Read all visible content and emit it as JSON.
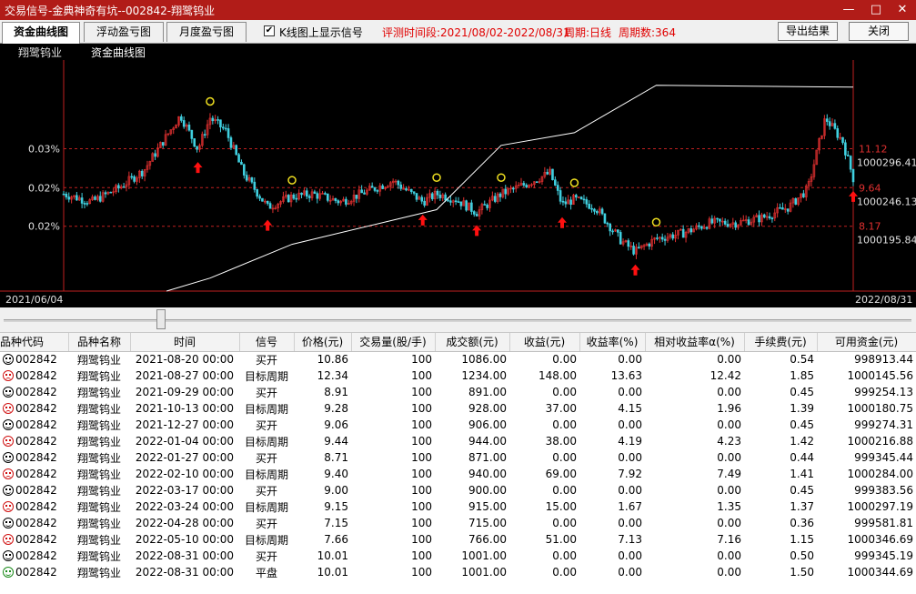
{
  "window": {
    "title": "交易信号-金典神奇有坑--002842-翔鹭钨业",
    "controls": {
      "minimize": "—",
      "maximize": "□",
      "close": "✕"
    }
  },
  "toolbar": {
    "tabs": [
      {
        "label": "资金曲线图",
        "active": true
      },
      {
        "label": "浮动盈亏图",
        "active": false
      },
      {
        "label": "月度盈亏图",
        "active": false
      }
    ],
    "checkbox_checked": true,
    "checkbox_label": "K线图上显示信号",
    "period_text": "评测时间段:2021/08/02-2022/08/31",
    "cycle_text": "周期:日线",
    "cycle_count_text": "周期数:364",
    "export_button": "导出结果",
    "close_button": "关闭"
  },
  "chart_data": {
    "type": "line",
    "legend": [
      "翔鹭钨业",
      "资金曲线图"
    ],
    "x_start_label": "2021/06/04",
    "x_end_label": "2022/08/31",
    "left_axis_labels": [
      "0.03%",
      "0.02%",
      "0.02%"
    ],
    "right_price_labels": [
      "11.12",
      "9.64",
      "8.17"
    ],
    "right_equity_labels": [
      "1000296.41",
      "1000246.13",
      "1000195.84"
    ],
    "price_ylim": [
      5.7,
      14.5
    ],
    "equity_ylim": [
      1000132,
      1000373
    ],
    "equity_series": {
      "name": "资金曲线图",
      "color": "#ffffff",
      "x": [
        "2021-08-02",
        "2021-08-27",
        "2021-10-13",
        "2022-01-04",
        "2022-02-10",
        "2022-03-24",
        "2022-05-10",
        "2022-08-31"
      ],
      "values": [
        1000132,
        1000145.56,
        1000180.75,
        1000216.88,
        1000284.0,
        1000297.19,
        1000346.69,
        1000344.69
      ]
    },
    "price_series": {
      "name": "翔鹭钨业",
      "up_color": "#e03030",
      "down_color": "#40d0e0",
      "x": [
        "2021-06-04",
        "2021-06-20",
        "2021-07-05",
        "2021-07-20",
        "2021-08-02",
        "2021-08-10",
        "2021-08-20",
        "2021-08-27",
        "2021-09-05",
        "2021-09-15",
        "2021-09-29",
        "2021-10-13",
        "2021-10-25",
        "2021-11-10",
        "2021-11-25",
        "2021-12-10",
        "2021-12-27",
        "2022-01-04",
        "2022-01-15",
        "2022-01-27",
        "2022-02-10",
        "2022-02-25",
        "2022-03-10",
        "2022-03-17",
        "2022-03-24",
        "2022-04-05",
        "2022-04-20",
        "2022-04-28",
        "2022-05-10",
        "2022-05-25",
        "2022-06-10",
        "2022-06-25",
        "2022-07-10",
        "2022-07-25",
        "2022-08-05",
        "2022-08-15",
        "2022-08-25",
        "2022-08-31"
      ],
      "values": [
        9.4,
        9.1,
        9.6,
        10.3,
        11.6,
        12.4,
        11.1,
        12.3,
        11.8,
        10.2,
        8.9,
        9.3,
        9.4,
        9.1,
        9.5,
        9.9,
        9.1,
        9.4,
        9.2,
        8.7,
        9.4,
        9.8,
        10.2,
        9.0,
        9.2,
        8.9,
        7.6,
        7.2,
        7.7,
        7.9,
        8.3,
        8.3,
        8.5,
        8.9,
        9.6,
        12.3,
        11.4,
        10.0
      ]
    },
    "signals": [
      {
        "date": "2021-08-20",
        "kind": "buy"
      },
      {
        "date": "2021-08-27",
        "kind": "sell"
      },
      {
        "date": "2021-09-29",
        "kind": "buy"
      },
      {
        "date": "2021-10-13",
        "kind": "sell"
      },
      {
        "date": "2021-12-27",
        "kind": "buy"
      },
      {
        "date": "2022-01-04",
        "kind": "sell"
      },
      {
        "date": "2022-01-27",
        "kind": "buy"
      },
      {
        "date": "2022-02-10",
        "kind": "sell"
      },
      {
        "date": "2022-03-17",
        "kind": "buy"
      },
      {
        "date": "2022-03-24",
        "kind": "sell"
      },
      {
        "date": "2022-04-28",
        "kind": "buy"
      },
      {
        "date": "2022-05-10",
        "kind": "sell"
      },
      {
        "date": "2022-08-31",
        "kind": "buy"
      }
    ]
  },
  "table": {
    "headers": [
      "品种代码",
      "品种名称",
      "时间",
      "信号",
      "价格(元)",
      "交易量(股/手)",
      "成交额(元)",
      "收益(元)",
      "收益率(%)",
      "相对收益率α(%)",
      "手续费(元)",
      "可用资金(元)"
    ],
    "rows": [
      {
        "face": "black",
        "code": "002842",
        "name": "翔鹭钨业",
        "time": "2021-08-20 00:00",
        "signal": "买开",
        "price": "10.86",
        "volume": "100",
        "amount": "1086.00",
        "profit": "0.00",
        "rate": "0.00",
        "alpha": "0.00",
        "fee": "0.54",
        "cash": "998913.44"
      },
      {
        "face": "red",
        "code": "002842",
        "name": "翔鹭钨业",
        "time": "2021-08-27 00:00",
        "signal": "目标周期",
        "price": "12.34",
        "volume": "100",
        "amount": "1234.00",
        "profit": "148.00",
        "rate": "13.63",
        "alpha": "12.42",
        "fee": "1.85",
        "cash": "1000145.56"
      },
      {
        "face": "black",
        "code": "002842",
        "name": "翔鹭钨业",
        "time": "2021-09-29 00:00",
        "signal": "买开",
        "price": "8.91",
        "volume": "100",
        "amount": "891.00",
        "profit": "0.00",
        "rate": "0.00",
        "alpha": "0.00",
        "fee": "0.45",
        "cash": "999254.13"
      },
      {
        "face": "red",
        "code": "002842",
        "name": "翔鹭钨业",
        "time": "2021-10-13 00:00",
        "signal": "目标周期",
        "price": "9.28",
        "volume": "100",
        "amount": "928.00",
        "profit": "37.00",
        "rate": "4.15",
        "alpha": "1.96",
        "fee": "1.39",
        "cash": "1000180.75"
      },
      {
        "face": "black",
        "code": "002842",
        "name": "翔鹭钨业",
        "time": "2021-12-27 00:00",
        "signal": "买开",
        "price": "9.06",
        "volume": "100",
        "amount": "906.00",
        "profit": "0.00",
        "rate": "0.00",
        "alpha": "0.00",
        "fee": "0.45",
        "cash": "999274.31"
      },
      {
        "face": "red",
        "code": "002842",
        "name": "翔鹭钨业",
        "time": "2022-01-04 00:00",
        "signal": "目标周期",
        "price": "9.44",
        "volume": "100",
        "amount": "944.00",
        "profit": "38.00",
        "rate": "4.19",
        "alpha": "4.23",
        "fee": "1.42",
        "cash": "1000216.88"
      },
      {
        "face": "black",
        "code": "002842",
        "name": "翔鹭钨业",
        "time": "2022-01-27 00:00",
        "signal": "买开",
        "price": "8.71",
        "volume": "100",
        "amount": "871.00",
        "profit": "0.00",
        "rate": "0.00",
        "alpha": "0.00",
        "fee": "0.44",
        "cash": "999345.44"
      },
      {
        "face": "red",
        "code": "002842",
        "name": "翔鹭钨业",
        "time": "2022-02-10 00:00",
        "signal": "目标周期",
        "price": "9.40",
        "volume": "100",
        "amount": "940.00",
        "profit": "69.00",
        "rate": "7.92",
        "alpha": "7.49",
        "fee": "1.41",
        "cash": "1000284.00"
      },
      {
        "face": "black",
        "code": "002842",
        "name": "翔鹭钨业",
        "time": "2022-03-17 00:00",
        "signal": "买开",
        "price": "9.00",
        "volume": "100",
        "amount": "900.00",
        "profit": "0.00",
        "rate": "0.00",
        "alpha": "0.00",
        "fee": "0.45",
        "cash": "999383.56"
      },
      {
        "face": "red",
        "code": "002842",
        "name": "翔鹭钨业",
        "time": "2022-03-24 00:00",
        "signal": "目标周期",
        "price": "9.15",
        "volume": "100",
        "amount": "915.00",
        "profit": "15.00",
        "rate": "1.67",
        "alpha": "1.35",
        "fee": "1.37",
        "cash": "1000297.19"
      },
      {
        "face": "black",
        "code": "002842",
        "name": "翔鹭钨业",
        "time": "2022-04-28 00:00",
        "signal": "买开",
        "price": "7.15",
        "volume": "100",
        "amount": "715.00",
        "profit": "0.00",
        "rate": "0.00",
        "alpha": "0.00",
        "fee": "0.36",
        "cash": "999581.81"
      },
      {
        "face": "red",
        "code": "002842",
        "name": "翔鹭钨业",
        "time": "2022-05-10 00:00",
        "signal": "目标周期",
        "price": "7.66",
        "volume": "100",
        "amount": "766.00",
        "profit": "51.00",
        "rate": "7.13",
        "alpha": "7.16",
        "fee": "1.15",
        "cash": "1000346.69"
      },
      {
        "face": "black",
        "code": "002842",
        "name": "翔鹭钨业",
        "time": "2022-08-31 00:00",
        "signal": "买开",
        "price": "10.01",
        "volume": "100",
        "amount": "1001.00",
        "profit": "0.00",
        "rate": "0.00",
        "alpha": "0.00",
        "fee": "0.50",
        "cash": "999345.19"
      },
      {
        "face": "green",
        "code": "002842",
        "name": "翔鹭钨业",
        "time": "2022-08-31 00:00",
        "signal": "平盘",
        "price": "10.01",
        "volume": "100",
        "amount": "1001.00",
        "profit": "0.00",
        "rate": "0.00",
        "alpha": "0.00",
        "fee": "1.50",
        "cash": "1000344.69"
      }
    ]
  }
}
